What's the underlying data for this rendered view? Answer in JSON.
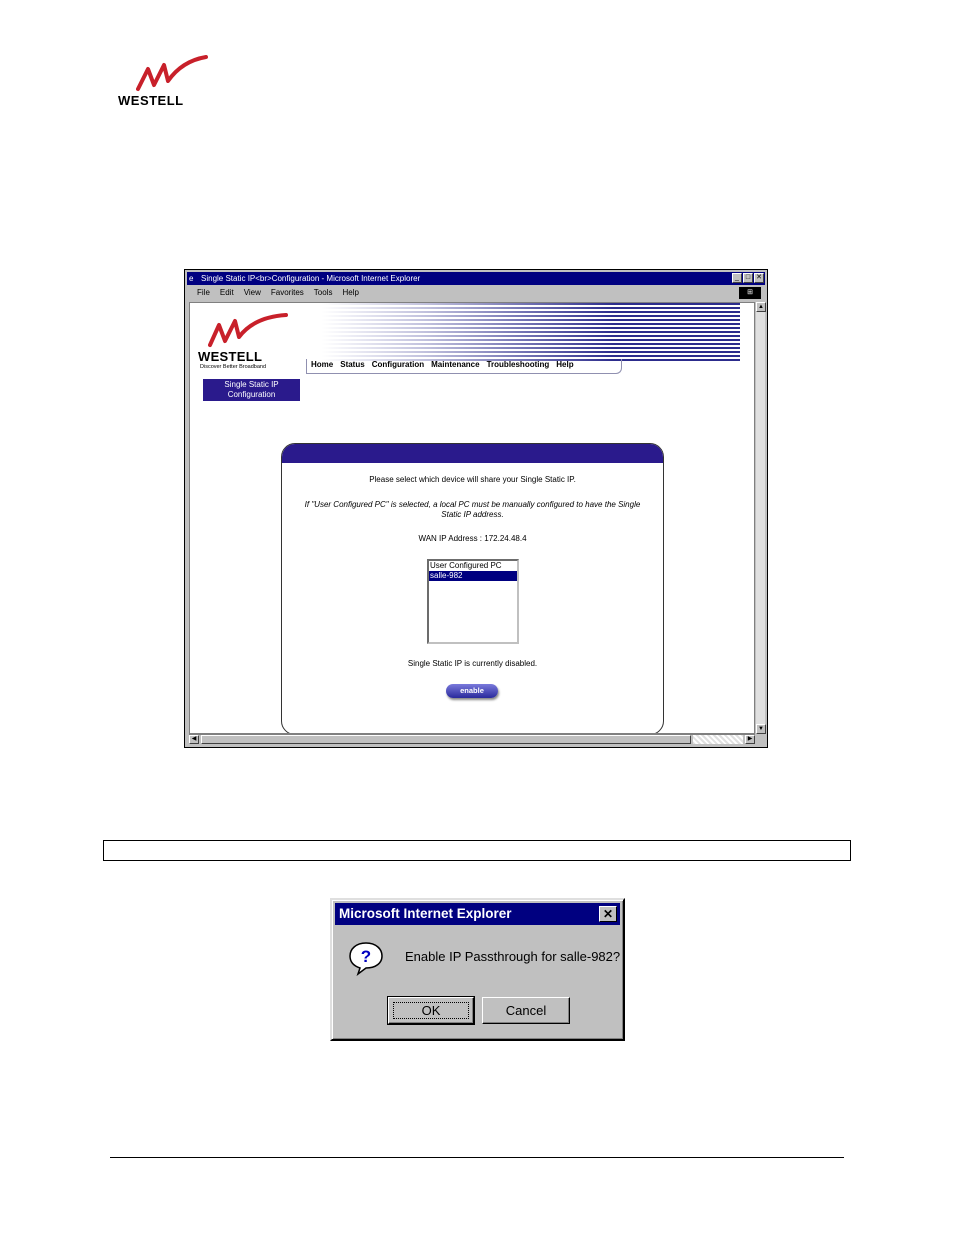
{
  "page": {
    "logo_text": "WESTELL"
  },
  "browser": {
    "title": "Single Static IP<br>Configuration - Microsoft Internet Explorer",
    "menu": [
      "File",
      "Edit",
      "View",
      "Favorites",
      "Tools",
      "Help"
    ]
  },
  "router_page": {
    "logo_text": "WESTELL",
    "tagline": "Discover Better Broadband",
    "nav": [
      "Home",
      "Status",
      "Configuration",
      "Maintenance",
      "Troubleshooting",
      "Help"
    ],
    "section_label": "Single Static IP Configuration",
    "prompt": "Please select which device will share your Single Static IP.",
    "note": "If \"User Configured PC\" is selected, a local PC must be manually configured to have the Single Static IP address.",
    "wan_label": "WAN IP Address :",
    "wan_ip": "172.24.48.4",
    "devices": [
      "User Configured PC",
      "salle-982"
    ],
    "selected_device": "salle-982",
    "status": "Single Static IP is currently disabled.",
    "enable_label": "enable"
  },
  "dialog": {
    "title": "Microsoft Internet Explorer",
    "close_label": "✕",
    "message": "Enable IP Passthrough for salle-982?",
    "ok_label": "OK",
    "cancel_label": "Cancel"
  }
}
